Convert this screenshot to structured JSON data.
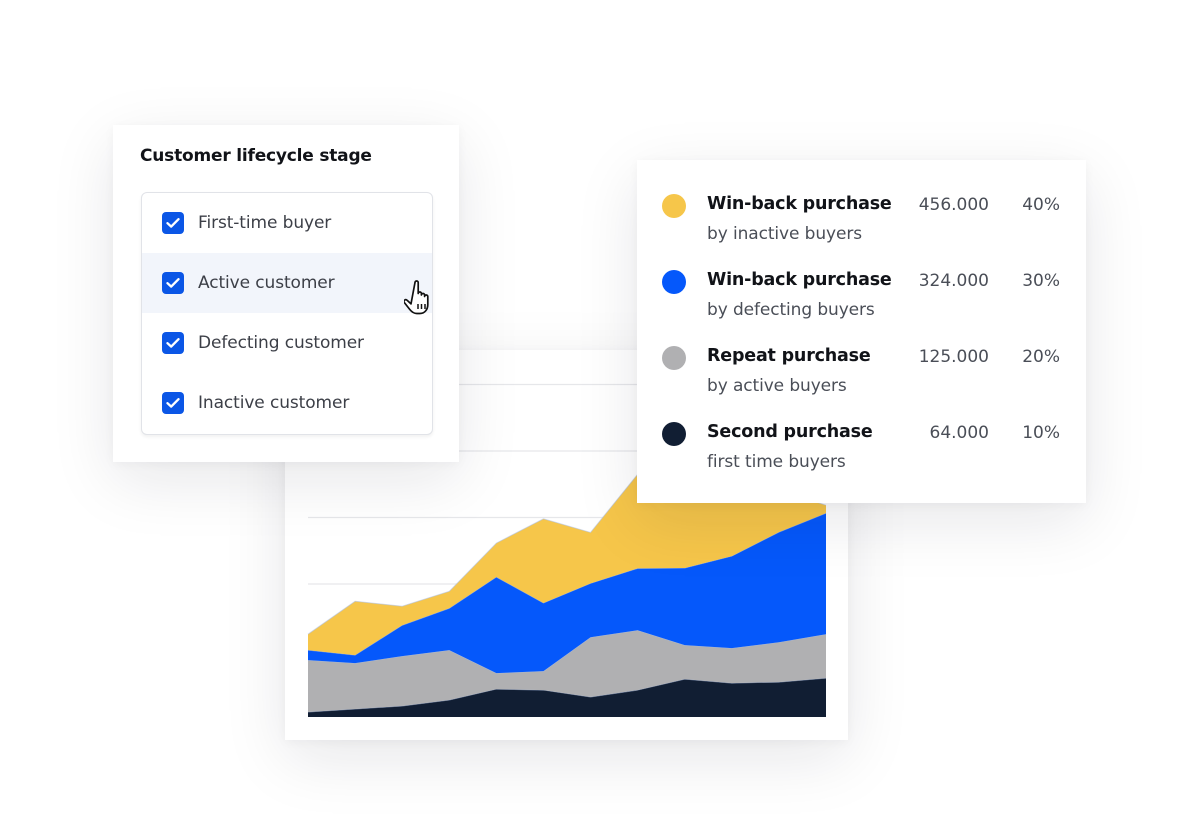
{
  "filter": {
    "title": "Customer lifecycle stage",
    "items": [
      {
        "label": "First-time buyer",
        "checked": true,
        "hovered": false
      },
      {
        "label": "Active customer",
        "checked": true,
        "hovered": true
      },
      {
        "label": "Defecting customer",
        "checked": true,
        "hovered": false
      },
      {
        "label": "Inactive customer",
        "checked": true,
        "hovered": false
      }
    ],
    "checkbox_color": "#0b56e6",
    "cursor_icon": "hand-pointer-icon"
  },
  "legend": {
    "items": [
      {
        "name": "Win-back purchase",
        "sub": "by inactive buyers",
        "value": "456.000",
        "percent": "40%",
        "color": "#f6c64a"
      },
      {
        "name": "Win-back purchase",
        "sub": "by defecting buyers",
        "value": "324.000",
        "percent": "30%",
        "color": "#0558fb"
      },
      {
        "name": "Repeat purchase",
        "sub": "by active buyers",
        "value": "125.000",
        "percent": "20%",
        "color": "#b0b0b2"
      },
      {
        "name": "Second purchase",
        "sub": "first time buyers",
        "value": "64.000",
        "percent": "10%",
        "color": "#111e33"
      }
    ]
  },
  "chart_data": {
    "type": "area",
    "stacked": true,
    "title": "",
    "xlabel": "",
    "ylabel": "",
    "x": [
      1,
      2,
      3,
      4,
      5,
      6,
      7,
      8,
      9,
      10,
      11,
      12
    ],
    "ylim": [
      0,
      100
    ],
    "grid": true,
    "gridlines": [
      20,
      40,
      60,
      80,
      100
    ],
    "legend": "right",
    "series": [
      {
        "name": "Second purchase — first time buyers",
        "color": "#111e33",
        "values": [
          1.5,
          2.4,
          3.3,
          5.1,
          8.4,
          8.1,
          6.0,
          8.1,
          11.4,
          10.2,
          10.5,
          11.7
        ]
      },
      {
        "name": "Repeat purchase — by active buyers",
        "color": "#b0b0b2",
        "values": [
          15.6,
          13.8,
          15.0,
          15.0,
          4.8,
          5.7,
          18.0,
          18.0,
          10.2,
          10.5,
          12.0,
          13.2
        ]
      },
      {
        "name": "Win-back purchase — by defecting buyers",
        "color": "#0558fb",
        "values": [
          3.0,
          2.4,
          9.3,
          12.6,
          28.9,
          20.5,
          16.2,
          18.6,
          23.2,
          27.7,
          33.1,
          36.4
        ]
      },
      {
        "name": "Win-back purchase — by inactive buyers",
        "color": "#f6c64a",
        "values": [
          4.8,
          16.2,
          5.7,
          5.1,
          10.2,
          25.3,
          15.3,
          28.3,
          20.5,
          18.3,
          12.6,
          2.4
        ]
      }
    ]
  }
}
